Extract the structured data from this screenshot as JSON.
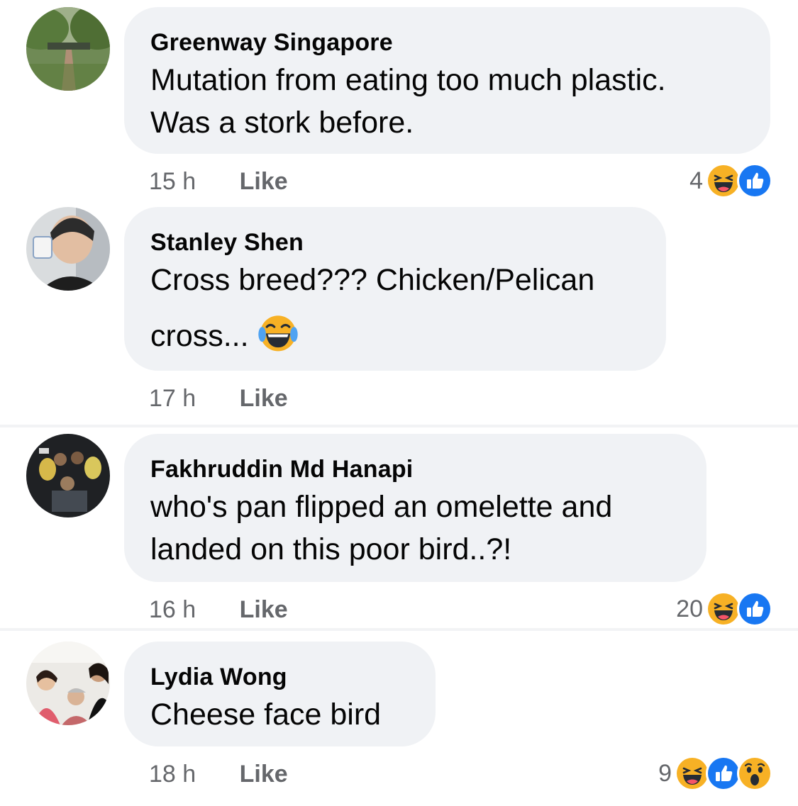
{
  "comments": [
    {
      "author": "Greenway Singapore",
      "lines": [
        "Mutation from eating too much plastic.",
        "Was a stork before."
      ],
      "time": "15 h",
      "like_label": "Like",
      "reaction_count": "4",
      "reactions": [
        "haha-icon",
        "like-icon"
      ]
    },
    {
      "author": "Stanley Shen",
      "lines": [
        "Cross breed??? Chicken/Pelican",
        "cross..."
      ],
      "inline_emoji": "tears-of-joy-emoji",
      "time": "17 h",
      "like_label": "Like"
    },
    {
      "author": "Fakhruddin Md Hanapi",
      "lines": [
        "who's pan flipped an omelette and",
        "landed on this poor bird..?!"
      ],
      "time": "16 h",
      "like_label": "Like",
      "reaction_count": "20",
      "reactions": [
        "haha-icon",
        "like-icon"
      ]
    },
    {
      "author": "Lydia Wong",
      "lines": [
        "Cheese face bird"
      ],
      "time": "18 h",
      "like_label": "Like",
      "reaction_count": "9",
      "reactions": [
        "haha-icon",
        "like-icon",
        "wow-icon"
      ]
    }
  ],
  "colors": {
    "bubble": "#f0f2f5",
    "meta_text": "#65676b",
    "like_blue": "#1877f2",
    "emoji_yellow": "#f7b125"
  }
}
